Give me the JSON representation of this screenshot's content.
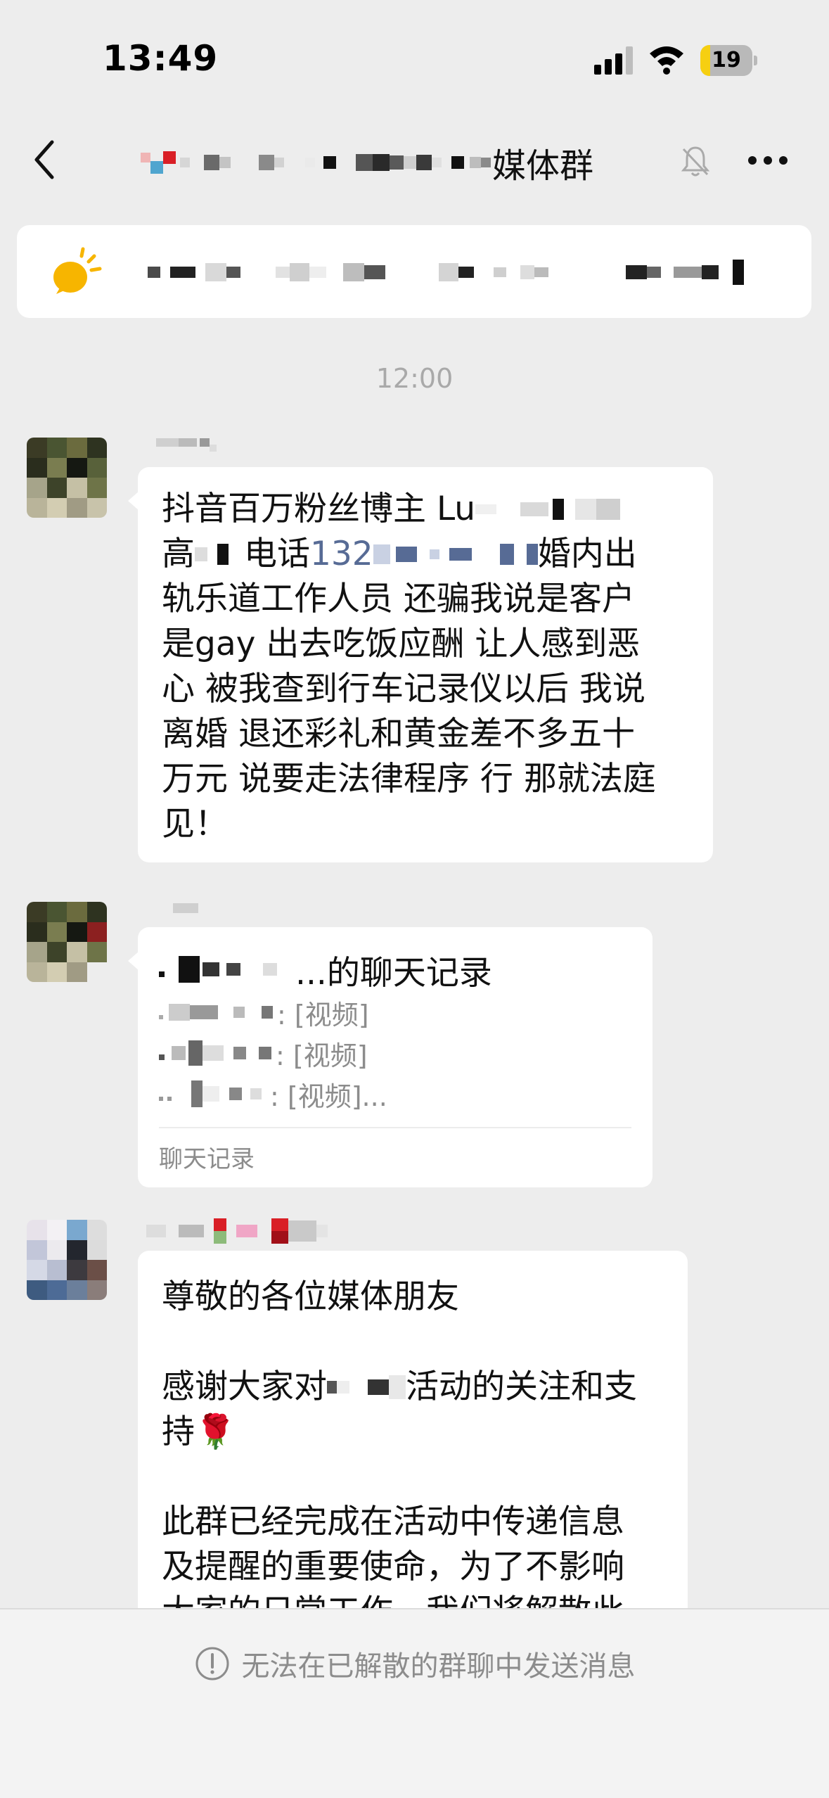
{
  "status_bar": {
    "time": "13:49",
    "battery_level": "19",
    "battery_fraction": 0.19
  },
  "nav": {
    "title_suffix": "媒体群"
  },
  "time_divider": "12:00",
  "messages": [
    {
      "type": "text",
      "lines": [
        {
          "before": "抖音百万粉丝博主 Lu",
          "after": ""
        },
        {
          "before": "高",
          "mid": "电话",
          "phone": "132",
          "after": "婚内出"
        },
        {
          "before": "轨乐道工作人员 还骗我说是客户"
        },
        {
          "before": "是gay 出去吃饭应酬 让人感到恶"
        },
        {
          "before": "心 被我查到行车记录仪以后 我说"
        },
        {
          "before": "离婚 退还彩礼和黄金差不多五十"
        },
        {
          "before": "万元 说要走法律程序 行 那就法庭"
        },
        {
          "before": "见！"
        }
      ]
    },
    {
      "type": "chat_record",
      "title": "...的聊天记录",
      "items": [
        ": [视频]",
        ": [视频]",
        ": [视频]..."
      ],
      "footer": "聊天记录"
    },
    {
      "type": "text",
      "lines": [
        {
          "before": "尊敬的各位媒体朋友"
        },
        {
          "before": ""
        },
        {
          "before": "感谢大家对",
          "after": "活动的关注和支"
        },
        {
          "before": "持🌹"
        },
        {
          "before": ""
        },
        {
          "before": "此群已经完成在活动中传递信息"
        },
        {
          "before": "及提醒的重要使命，为了不影响"
        },
        {
          "before": "大家的日常工作，我们将解散此"
        }
      ]
    }
  ],
  "bottom_bar": {
    "text": "无法在已解散的群聊中发送消息"
  },
  "colors": {
    "background": "#ededed",
    "bubble": "#ffffff",
    "link": "#576b95",
    "battery": "#f6cf11"
  },
  "icons": [
    "back-icon",
    "mute-bell-icon",
    "more-icon",
    "speaker-icon",
    "warning-icon",
    "rose-icon"
  ]
}
